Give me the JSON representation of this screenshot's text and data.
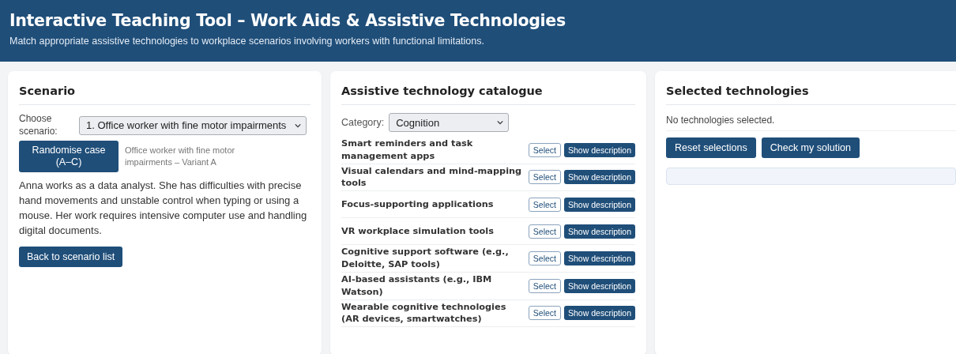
{
  "header": {
    "title": "Interactive Teaching Tool – Work Aids & Assistive Technologies",
    "subtitle": "Match appropriate assistive technologies to workplace scenarios involving workers with functional limitations."
  },
  "scenario_panel": {
    "title": "Scenario",
    "choose_label": "Choose scenario:",
    "scenario_select": "1. Office worker with fine motor impairments",
    "randomise_button": "Randomise case (A–C)",
    "case_label": "Office worker with fine motor impairments – Variant A",
    "description": "Anna works as a data analyst. She has difficulties with precise hand movements and unstable control when typing or using a mouse. Her work requires intensive computer use and handling digital documents.",
    "back_button": "Back to scenario list"
  },
  "catalogue_panel": {
    "title": "Assistive technology catalogue",
    "category_label": "Category:",
    "category_select": "Cognition",
    "items": [
      {
        "name": "Smart reminders and task management apps",
        "select_button": "Select",
        "description_button": "Show description",
        "selected": false
      },
      {
        "name": "Visual calendars and mind-mapping tools",
        "select_button": "Select",
        "description_button": "Show description",
        "selected": false
      },
      {
        "name": "Focus-supporting applications",
        "select_button": "Select",
        "description_button": "Show description",
        "selected": false
      },
      {
        "name": "VR workplace simulation tools",
        "select_button": "Select",
        "description_button": "Show description",
        "selected": false
      },
      {
        "name": "Cognitive support software (e.g., Deloitte, SAP tools)",
        "select_button": "Select",
        "description_button": "Show description",
        "selected": false
      },
      {
        "name": "AI-based assistants (e.g., IBM Watson)",
        "select_button": "Select",
        "description_button": "Show description",
        "selected": false
      },
      {
        "name": "Wearable cognitive technologies (AR devices, smartwatches)",
        "select_button": "Select",
        "description_button": "Show description",
        "selected": false
      }
    ]
  },
  "selected_panel": {
    "title": "Selected technologies",
    "empty_message": "No technologies selected.",
    "reset_button": "Reset selections",
    "check_button": "Check my solution"
  }
}
